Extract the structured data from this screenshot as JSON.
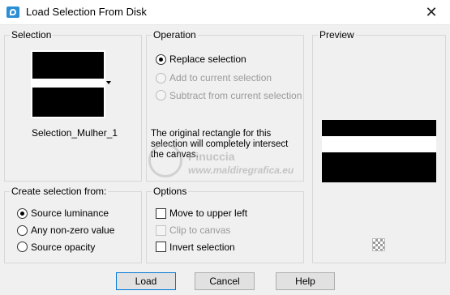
{
  "window": {
    "title": "Load Selection From Disk",
    "close_glyph": "✕"
  },
  "selection": {
    "label": "Selection",
    "name": "Selection_Mulher_1"
  },
  "operation": {
    "label": "Operation",
    "options": [
      "Replace selection",
      "Add to current selection",
      "Subtract from current selection"
    ],
    "selected": "Replace selection",
    "info": "The original rectangle for this selection will completely intersect the canvas."
  },
  "preview": {
    "label": "Preview"
  },
  "create_from": {
    "label": "Create selection from:",
    "options": [
      "Source luminance",
      "Any non-zero value",
      "Source opacity"
    ],
    "selected": "Source luminance"
  },
  "options": {
    "label": "Options",
    "move_upper_left": "Move to upper left",
    "clip_to_canvas": "Clip to canvas",
    "invert_selection": "Invert selection"
  },
  "buttons": {
    "load": "Load",
    "cancel": "Cancel",
    "help": "Help"
  },
  "watermark": {
    "name": "Pinuccia",
    "url": "www.maldiregrafica.eu"
  }
}
